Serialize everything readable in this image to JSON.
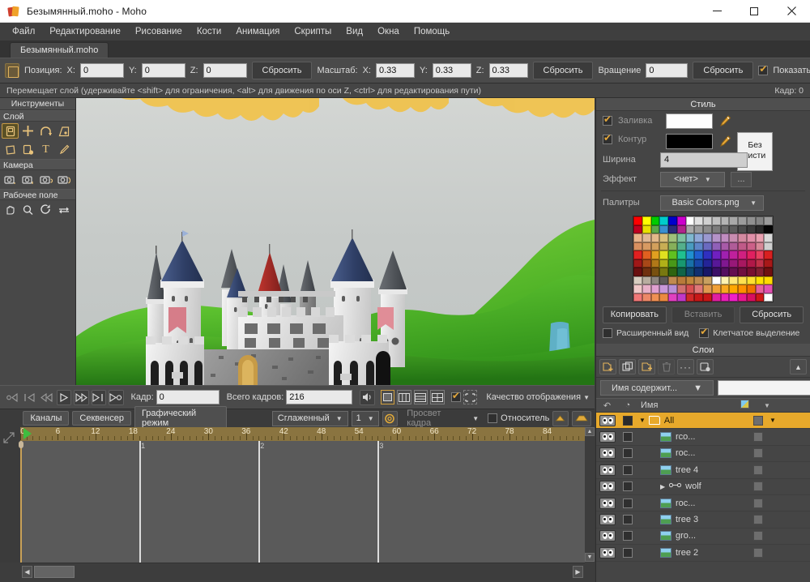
{
  "window": {
    "title": "Безымянный.moho - Moho",
    "app_icon": "moho-logo-icon",
    "minimize": "–",
    "maximize": "□",
    "close": "×"
  },
  "menu": {
    "items": [
      {
        "label": "Файл"
      },
      {
        "label": "Редактирование"
      },
      {
        "label": "Рисование"
      },
      {
        "label": "Кости"
      },
      {
        "label": "Анимация"
      },
      {
        "label": "Скрипты"
      },
      {
        "label": "Вид"
      },
      {
        "label": "Окна"
      },
      {
        "label": "Помощь"
      }
    ]
  },
  "doc_tab": {
    "label": "Безымянный.moho"
  },
  "options_bar": {
    "position_label": "Позиция:",
    "x_label": "X:",
    "y_label": "Y:",
    "z_label": "Z:",
    "pos_x": "0",
    "pos_y": "0",
    "pos_z": "0",
    "reset_pos": "Сбросить",
    "scale_label": "Масштаб:",
    "scale_x_label": "X:",
    "scale_y_label": "Y:",
    "scale_z_label": "Z:",
    "scale_x": "0.33",
    "scale_y": "0.33",
    "scale_z": "0.33",
    "reset_scale": "Сбросить",
    "rotate_label": "Вращение",
    "rotate": "0",
    "reset_rotate": "Сбросить",
    "show_label": "Показать пути"
  },
  "status": {
    "hint": "Перемещает слой (удерживайте <shift> для ограничения, <alt> для движения по оси Z, <ctrl> для редактирования пути)",
    "frame": "Кадр: 0"
  },
  "tools": {
    "title": "Инструменты",
    "groups": [
      {
        "name": "Слой",
        "items": [
          {
            "label": "transform-layer-tool",
            "glyph": "▱",
            "selected": true
          },
          {
            "label": "move-layer-tool",
            "glyph": "✛",
            "selected": false
          },
          {
            "label": "rotate-layer-tool",
            "glyph": "↷",
            "selected": false
          },
          {
            "label": "shear-layer-tool",
            "glyph": "◲",
            "selected": false
          },
          {
            "label": "flip-layer-tool",
            "glyph": "◰",
            "selected": false
          },
          {
            "label": "set-origin-tool",
            "glyph": "◩",
            "selected": false
          },
          {
            "label": "text-tool",
            "glyph": "T",
            "selected": false
          },
          {
            "label": "eyedropper-tool",
            "glyph": "✎",
            "selected": false
          }
        ]
      },
      {
        "name": "Камера",
        "items": [
          {
            "label": "track-camera-tool",
            "glyph": "▣",
            "selected": false
          },
          {
            "label": "zoom-camera-tool",
            "glyph": "▣",
            "selected": false
          },
          {
            "label": "roll-camera-tool",
            "glyph": "▣",
            "selected": false
          },
          {
            "label": "pan-tilt-camera-tool",
            "glyph": "▣",
            "selected": false
          }
        ]
      },
      {
        "name": "Рабочее поле",
        "items": [
          {
            "label": "pan-workspace-tool",
            "glyph": "✋",
            "selected": false
          },
          {
            "label": "zoom-workspace-tool",
            "glyph": "🔍",
            "selected": false
          },
          {
            "label": "rotate-workspace-tool",
            "glyph": "↻",
            "selected": false
          },
          {
            "label": "orbit-workspace-tool",
            "glyph": "⇄",
            "selected": false
          }
        ]
      }
    ]
  },
  "style_panel": {
    "title": "Стиль",
    "fill_label": "Заливка",
    "fill_checked": true,
    "fill_color": "#ffffff",
    "stroke_label": "Контур",
    "stroke_checked": true,
    "stroke_color": "#000000",
    "no_brush_line1": "Без",
    "no_brush_line2": "кисти",
    "width_label": "Ширина",
    "width_value": "4",
    "effect_label": "Эффект",
    "effect_value": "<нет>",
    "more_button": "...",
    "palettes_label": "Палитры",
    "palette_name": "Basic Colors.png",
    "copy_button": "Копировать",
    "paste_button": "Вставить",
    "reset_button": "Сбросить",
    "extended_view_label": "Расширенный вид",
    "extended_view_checked": false,
    "checkered_select_label": "Клетчатое выделение",
    "checkered_select_checked": true
  },
  "layers_panel": {
    "title": "Слои",
    "toolbar": [
      {
        "name": "new-vector-layer-icon"
      },
      {
        "name": "duplicate-layer-icon"
      },
      {
        "name": "new-group-layer-icon"
      },
      {
        "name": "delete-layer-icon"
      },
      {
        "name": "more-options-icon"
      },
      {
        "name": "layer-settings-icon"
      },
      {
        "name": "collapse-panel-icon"
      }
    ],
    "filter_label": "Имя содержит...",
    "filter_value": "",
    "columns": {
      "visibility": "↶",
      "lock": "◔",
      "name": "Имя",
      "thumb": "▦",
      "menu": "▾"
    },
    "rows": [
      {
        "name": "All",
        "type": "group",
        "selected": true,
        "expanded": true,
        "indent": 0
      },
      {
        "name": "rco...",
        "type": "image",
        "selected": false,
        "indent": 1
      },
      {
        "name": "roc...",
        "type": "image",
        "selected": false,
        "indent": 1
      },
      {
        "name": "tree 4",
        "type": "image",
        "selected": false,
        "indent": 1
      },
      {
        "name": "wolf",
        "type": "bone",
        "selected": false,
        "indent": 1,
        "collapsed": true
      },
      {
        "name": "roc...",
        "type": "image",
        "selected": false,
        "indent": 1
      },
      {
        "name": "tree 3",
        "type": "image",
        "selected": false,
        "indent": 1
      },
      {
        "name": "gro...",
        "type": "image",
        "selected": false,
        "indent": 1
      },
      {
        "name": "tree 2",
        "type": "image",
        "selected": false,
        "indent": 1
      }
    ]
  },
  "playback": {
    "rewind_to_start": "◁",
    "prev_keyframe": "|◁",
    "step_back": "◁◁",
    "play": "▷",
    "fast_forward": "▷▷",
    "next_keyframe": "▷|",
    "loop": "▷◯",
    "frame_label": "Кадр:",
    "frame_value": "0",
    "total_label": "Всего кадров:",
    "total_value": "216",
    "audio_icon": "speaker-icon",
    "view_buttons": [
      "single-view",
      "two-column-view",
      "two-row-view",
      "quad-view"
    ],
    "onion_checked": true,
    "quality_label": "Качество отображения"
  },
  "channels_bar": {
    "tabs": [
      "Каналы",
      "Секвенсер",
      "Графический режим"
    ],
    "interp_value": "Сглаженный",
    "step_value": "1",
    "onion_icon": "onion-skin-icon",
    "onion_label": "Просвет кадра",
    "relative_label": "Относительн",
    "relative_checked": false
  },
  "timeline": {
    "ticks": [
      0,
      6,
      12,
      18,
      24,
      30,
      36,
      42,
      48,
      54,
      60,
      66,
      72,
      78,
      84
    ],
    "max_frame": 90,
    "playhead_frame": 0,
    "markers": [
      {
        "label": "1",
        "frame": 19
      },
      {
        "label": "2",
        "frame": 38
      },
      {
        "label": "3",
        "frame": 57
      }
    ]
  },
  "palette_colors": [
    [
      "#ff0000",
      "#ffff00",
      "#00cc00",
      "#00cccc",
      "#0000cc",
      "#cc00cc",
      "#ffffff",
      "#e0e0e0",
      "#d0d0d0",
      "#c0c0c0",
      "#b4b4b4",
      "#a8a8a8",
      "#9c9c9c",
      "#909090",
      "#848484",
      "#9a9a9a"
    ],
    [
      "#c00020",
      "#e8e000",
      "#5aa84a",
      "#3a8fd0",
      "#2a2a7a",
      "#b0248c",
      "#a8a8a8",
      "#9c9c9c",
      "#8c8c8c",
      "#7c7c7c",
      "#6c6c6c",
      "#5c5c5c",
      "#4c4c4c",
      "#3c3c3c",
      "#2a2a2a",
      "#050505"
    ],
    [
      "#e8b38a",
      "#e0b894",
      "#e3b98a",
      "#d9c07c",
      "#9fc07a",
      "#7cc0a0",
      "#7fb8d0",
      "#8fa8d8",
      "#9a98d0",
      "#b492c8",
      "#c08cc0",
      "#c88cb0",
      "#d489a0",
      "#e08fa8",
      "#e8a0b0",
      "#d9d9d9"
    ],
    [
      "#d99060",
      "#d89a62",
      "#d2a05c",
      "#c8ae54",
      "#86b05a",
      "#54b08c",
      "#4a9cc0",
      "#5e86c8",
      "#6a6ac0",
      "#9060b8",
      "#a85aa8",
      "#b05c98",
      "#c05a88",
      "#cc6088",
      "#d88898",
      "#cfcfcf"
    ],
    [
      "#e02020",
      "#e06020",
      "#e0a020",
      "#e0e020",
      "#60c020",
      "#20c090",
      "#2090d0",
      "#2060d0",
      "#3030c0",
      "#7020c0",
      "#a020b0",
      "#c0209c",
      "#d02080",
      "#e02060",
      "#e84060",
      "#d82020"
    ],
    [
      "#a01818",
      "#a84818",
      "#b07818",
      "#b0b018",
      "#489818",
      "#189870",
      "#1870a8",
      "#1848a8",
      "#242498",
      "#581898",
      "#801890",
      "#981878",
      "#a81860",
      "#b01848",
      "#c03048",
      "#a81818"
    ],
    [
      "#6a1010",
      "#703010",
      "#785010",
      "#787810",
      "#2e6410",
      "#106448",
      "#104a70",
      "#103070",
      "#181868",
      "#3c1068",
      "#541060",
      "#641050",
      "#701040",
      "#781030",
      "#801f30",
      "#701010"
    ],
    [
      "#d8cdc0",
      "#b8ada0",
      "#8e8680",
      "#5e5a58",
      "#c08a50",
      "#b87a3a",
      "#c0863c",
      "#c08a50",
      "#c8a060",
      "#ffffff",
      "#fff3b0",
      "#ffe878",
      "#ffe050",
      "#ffe030",
      "#ffe000",
      "#ffd800"
    ],
    [
      "#f0c8c8",
      "#e8b0c8",
      "#e0a0d0",
      "#c898d8",
      "#b890d8",
      "#d07070",
      "#d85050",
      "#e07878",
      "#e09a50",
      "#f0a038",
      "#f8a820",
      "#ffa800",
      "#ff9000",
      "#f07000",
      "#e8609c",
      "#e050b0"
    ],
    [
      "#f07878",
      "#ec8868",
      "#ee9054",
      "#ea8a40",
      "#e040c0",
      "#c038c8",
      "#d02828",
      "#c81818",
      "#c81818",
      "#e020a0",
      "#ea20b8",
      "#f020c8",
      "#e81890",
      "#d81060",
      "#d01818",
      "#ffffff"
    ]
  ]
}
